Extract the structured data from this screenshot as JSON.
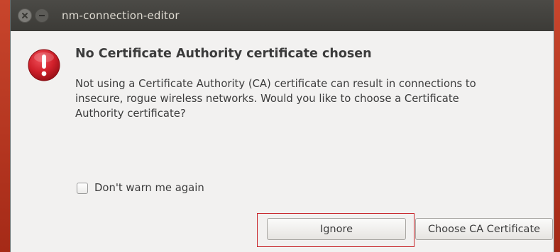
{
  "window": {
    "title": "nm-connection-editor"
  },
  "dialog": {
    "icon": "error-icon",
    "heading": "No Certificate Authority certificate chosen",
    "message_lines": [
      "Not using a Certificate Authority (CA) certificate can result in connections to",
      "insecure, rogue wireless networks.  Would you like to choose a Certificate",
      "Authority certificate?"
    ],
    "checkbox": {
      "label": "Don't warn me again",
      "checked": false
    },
    "buttons": {
      "ignore_label": "Ignore",
      "choose_label": "Choose CA Certificate"
    }
  },
  "colors": {
    "titlebar": "#3c3b37",
    "dialog_bg": "#f2f1f0",
    "error_red": "#d0202a",
    "highlight_border": "#c8262b",
    "desktop": "#b3351f"
  }
}
